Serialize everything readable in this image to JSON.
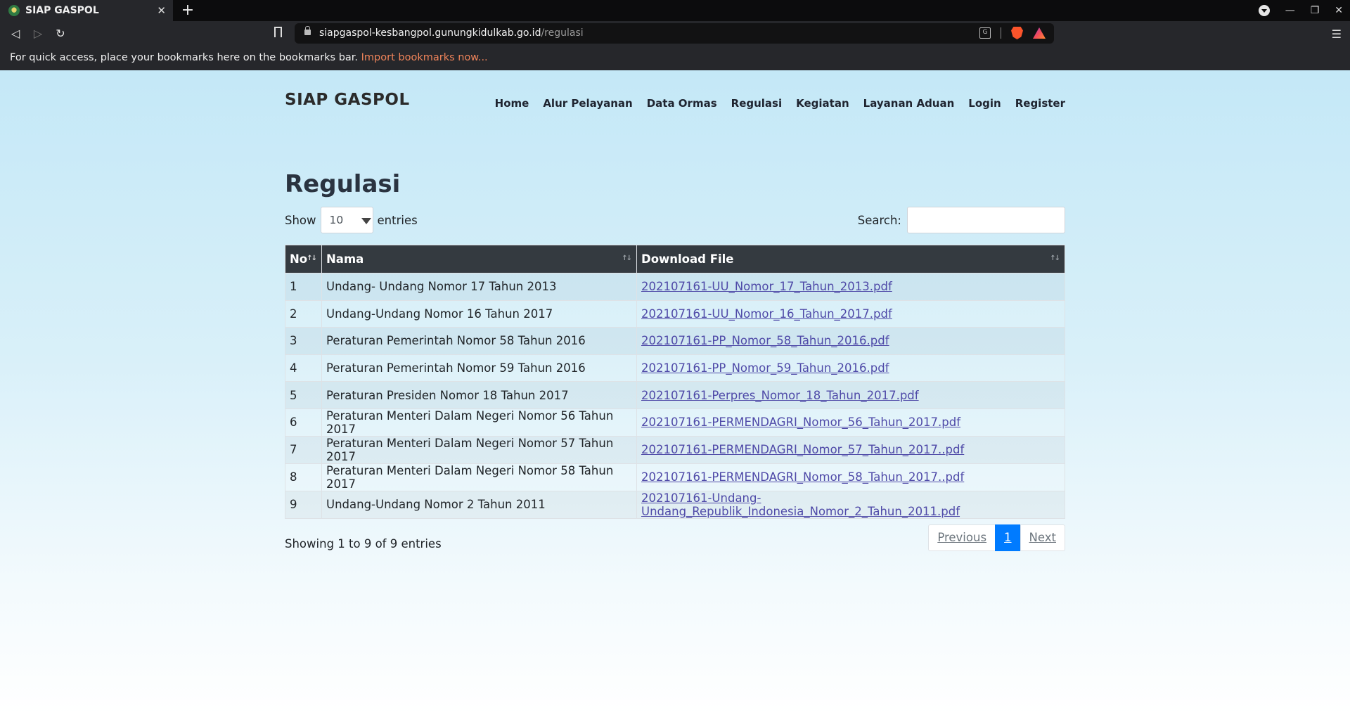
{
  "browser": {
    "tab_title": "SIAP GASPOL",
    "url_domain": "siapgaspol-kesbangpol.gunungkidulkab.go.id",
    "url_path": "/regulasi",
    "bookmarks_text": "For quick access, place your bookmarks here on the bookmarks bar.",
    "bookmarks_link": "Import bookmarks now..."
  },
  "site": {
    "brand": "SIAP GASPOL",
    "nav": [
      "Home",
      "Alur Pelayanan",
      "Data Ormas",
      "Regulasi",
      "Kegiatan",
      "Layanan Aduan",
      "Login",
      "Register"
    ]
  },
  "page": {
    "title": "Regulasi",
    "show_label": "Show",
    "entries_label": "entries",
    "page_length": "10",
    "search_label": "Search:",
    "search_value": ""
  },
  "table": {
    "columns": [
      "No",
      "Nama",
      "Download File"
    ],
    "rows": [
      {
        "no": "1",
        "nama": "Undang- Undang Nomor 17 Tahun 2013",
        "file": "202107161-UU_Nomor_17_Tahun_2013.pdf"
      },
      {
        "no": "2",
        "nama": "Undang-Undang Nomor 16 Tahun 2017",
        "file": "202107161-UU_Nomor_16_Tahun_2017.pdf"
      },
      {
        "no": "3",
        "nama": "Peraturan Pemerintah Nomor 58 Tahun 2016",
        "file": "202107161-PP_Nomor_58_Tahun_2016.pdf"
      },
      {
        "no": "4",
        "nama": "Peraturan Pemerintah Nomor 59 Tahun 2016",
        "file": "202107161-PP_Nomor_59_Tahun_2016.pdf"
      },
      {
        "no": "5",
        "nama": "Peraturan Presiden Nomor 18 Tahun 2017",
        "file": "202107161-Perpres_Nomor_18_Tahun_2017.pdf"
      },
      {
        "no": "6",
        "nama": "Peraturan Menteri Dalam Negeri Nomor 56 Tahun 2017",
        "file": "202107161-PERMENDAGRI_Nomor_56_Tahun_2017.pdf"
      },
      {
        "no": "7",
        "nama": "Peraturan Menteri Dalam Negeri Nomor 57 Tahun 2017",
        "file": "202107161-PERMENDAGRI_Nomor_57_Tahun_2017..pdf"
      },
      {
        "no": "8",
        "nama": "Peraturan Menteri Dalam Negeri Nomor 58 Tahun 2017",
        "file": "202107161-PERMENDAGRI_Nomor_58_Tahun_2017..pdf"
      },
      {
        "no": "9",
        "nama": "Undang-Undang Nomor 2 Tahun 2011",
        "file": "202107161-Undang-Undang_Republik_Indonesia_Nomor_2_Tahun_2011.pdf"
      }
    ]
  },
  "footer": {
    "info": "Showing 1 to 9 of 9 entries",
    "previous": "Previous",
    "current_page": "1",
    "next": "Next"
  }
}
